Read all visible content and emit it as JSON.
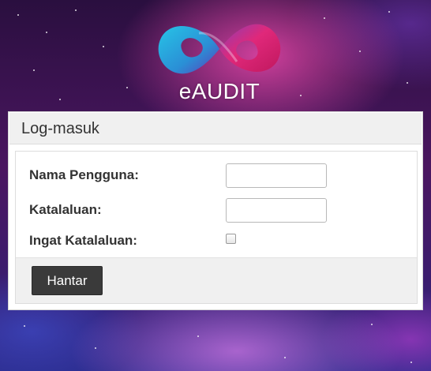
{
  "brand": {
    "logo_text": "eAUDIT",
    "colors": {
      "logo_cyan": "#2bb8d8",
      "logo_magenta": "#e0287a",
      "logo_purple": "#8a3fb4"
    }
  },
  "login_panel": {
    "title": "Log-masuk",
    "fields": {
      "username_label": "Nama Pengguna:",
      "username_value": "",
      "password_label": "Katalaluan:",
      "password_value": "",
      "remember_label": "Ingat Katalaluan:",
      "remember_checked": false
    },
    "submit_label": "Hantar"
  },
  "icons": {
    "logo": "infinity-logo-icon",
    "checkbox": "checkbox-icon"
  },
  "theme": {
    "button_bg": "#3a3a3a",
    "panel_heading_bg": "#f0f0f0",
    "background_style": "purple-pink galaxy"
  }
}
